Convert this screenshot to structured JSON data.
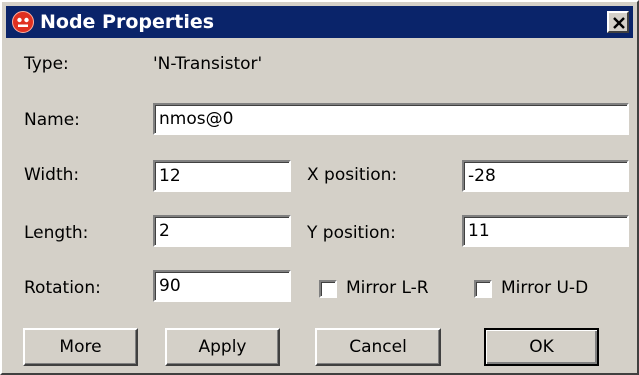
{
  "window": {
    "title": "Node Properties",
    "title_bar_color": "#0a246a",
    "title_text_color": "#ffffff",
    "icon": "app-node-icon",
    "close_icon": "close-icon"
  },
  "type": {
    "label": "Type:",
    "value": "'N-Transistor'"
  },
  "fields": {
    "name": {
      "label": "Name:",
      "value": "nmos@0"
    },
    "width": {
      "label": "Width:",
      "value": "12"
    },
    "length": {
      "label": "Length:",
      "value": "2"
    },
    "rotation": {
      "label": "Rotation:",
      "value": "90"
    },
    "x_position": {
      "label": "X position:",
      "value": "-28"
    },
    "y_position": {
      "label": "Y position:",
      "value": "11"
    }
  },
  "checkboxes": {
    "mirror_lr": {
      "label": "Mirror L-R",
      "checked": false
    },
    "mirror_ud": {
      "label": "Mirror U-D",
      "checked": false
    }
  },
  "buttons": {
    "more": "More",
    "apply": "Apply",
    "cancel": "Cancel",
    "ok": "OK"
  }
}
